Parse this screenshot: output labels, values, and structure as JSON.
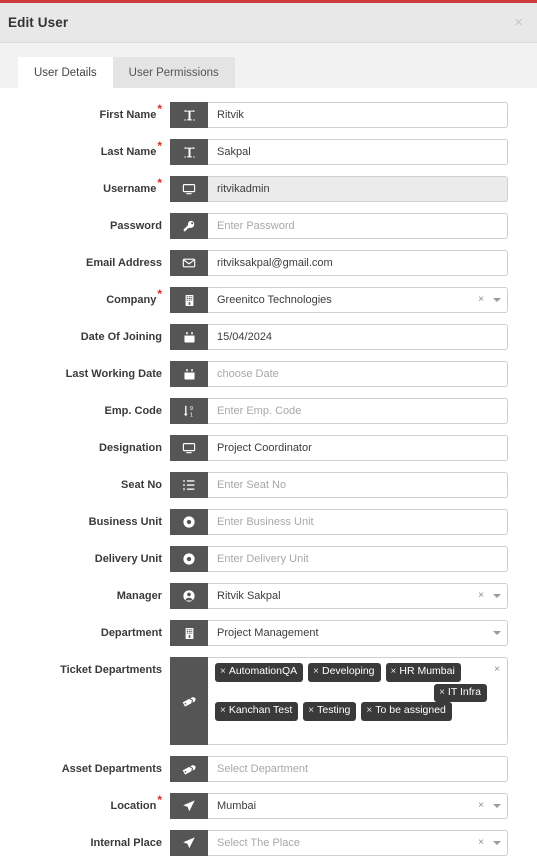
{
  "window": {
    "title": "Edit User",
    "close_label": "×",
    "accent_color": "#cf3c3c"
  },
  "tabs": [
    {
      "label": "User Details",
      "active": true
    },
    {
      "label": "User Permissions",
      "active": false
    }
  ],
  "form": {
    "fields": [
      {
        "label": "First Name",
        "required": true,
        "icon": "text-format-icon",
        "value": "Ritvik",
        "placeholder": "",
        "type": "text",
        "disabled": false
      },
      {
        "label": "Last Name",
        "required": true,
        "icon": "text-format-icon",
        "value": "Sakpal",
        "placeholder": "",
        "type": "text",
        "disabled": false
      },
      {
        "label": "Username",
        "required": true,
        "icon": "monitor-icon",
        "value": "ritvikadmin",
        "placeholder": "",
        "type": "text",
        "disabled": true
      },
      {
        "label": "Password",
        "required": false,
        "icon": "key-icon",
        "value": "",
        "placeholder": "Enter Password",
        "type": "text",
        "disabled": false
      },
      {
        "label": "Email Address",
        "required": false,
        "icon": "envelope-icon",
        "value": "ritviksakpal@gmail.com",
        "placeholder": "",
        "type": "text",
        "disabled": false
      },
      {
        "label": "Company",
        "required": true,
        "icon": "building-icon",
        "value": "Greenitco Technologies",
        "placeholder": "",
        "type": "select-clearable",
        "disabled": false
      },
      {
        "label": "Date Of Joining",
        "required": false,
        "icon": "calendar-icon",
        "value": "15/04/2024",
        "placeholder": "",
        "type": "text",
        "disabled": false
      },
      {
        "label": "Last Working Date",
        "required": false,
        "icon": "calendar-icon",
        "value": "",
        "placeholder": "choose Date",
        "type": "text",
        "disabled": false
      },
      {
        "label": "Emp. Code",
        "required": false,
        "icon": "sort-numeric-icon",
        "value": "",
        "placeholder": "Enter Emp. Code",
        "type": "text",
        "disabled": false
      },
      {
        "label": "Designation",
        "required": false,
        "icon": "monitor-icon",
        "value": "Project Coordinator",
        "placeholder": "",
        "type": "text",
        "disabled": false
      },
      {
        "label": "Seat No",
        "required": false,
        "icon": "list-ol-icon",
        "value": "",
        "placeholder": "Enter Seat No",
        "type": "text",
        "disabled": false
      },
      {
        "label": "Business Unit",
        "required": false,
        "icon": "dot-circle-icon",
        "value": "",
        "placeholder": "Enter Business Unit",
        "type": "text",
        "disabled": false
      },
      {
        "label": "Delivery Unit",
        "required": false,
        "icon": "dot-circle-icon",
        "value": "",
        "placeholder": "Enter Delivery Unit",
        "type": "text",
        "disabled": false
      },
      {
        "label": "Manager",
        "required": false,
        "icon": "user-circle-icon",
        "value": "Ritvik Sakpal",
        "placeholder": "",
        "type": "select-clearable",
        "disabled": false
      },
      {
        "label": "Department",
        "required": false,
        "icon": "building-icon",
        "value": "Project Management",
        "placeholder": "",
        "type": "select",
        "disabled": false
      }
    ],
    "ticket_departments": {
      "label": "Ticket Departments",
      "icon": "tags-icon",
      "clear_all_label": "×",
      "tag_remove_label": "×",
      "tags_line_1": [
        "AutomationQA",
        "Developing",
        "HR Mumbai"
      ],
      "tags_line_2": [
        "IT Infra"
      ],
      "tags_line_3": [
        "Kanchan Test",
        "Testing",
        "To be assigned"
      ]
    },
    "fields_after": [
      {
        "label": "Asset Departments",
        "required": false,
        "icon": "tags-icon",
        "value": "",
        "placeholder": "Select Department",
        "type": "text",
        "disabled": false
      },
      {
        "label": "Location",
        "required": true,
        "icon": "location-icon",
        "value": "Mumbai",
        "placeholder": "",
        "type": "select-clearable",
        "disabled": false
      },
      {
        "label": "Internal Place",
        "required": false,
        "icon": "location-icon",
        "value": "",
        "placeholder": "Select The Place",
        "type": "select-clearable",
        "disabled": false
      }
    ]
  }
}
